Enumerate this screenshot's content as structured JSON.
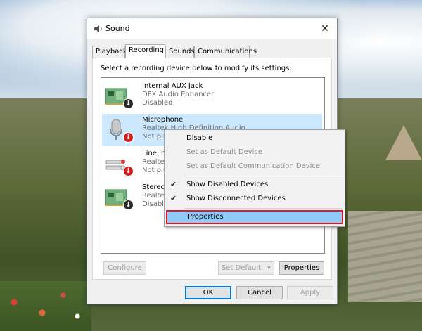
{
  "window": {
    "title": "Sound",
    "close_glyph": "✕",
    "tabs": [
      "Playback",
      "Recording",
      "Sounds",
      "Communications"
    ],
    "active_tab": "Recording",
    "instruction": "Select a recording device below to modify its settings:",
    "devices": [
      {
        "name": "Internal AUX Jack",
        "sub": "DFX Audio Enhancer",
        "status": "Disabled",
        "icon": "circuit-board-icon",
        "badge": "down-arrow-dark"
      },
      {
        "name": "Microphone",
        "sub": "Realtek High Definition Audio",
        "status": "Not plugged in",
        "icon": "microphone-icon",
        "badge": "down-arrow-red"
      },
      {
        "name": "Line In",
        "sub": "Realtek",
        "status": "Not plu",
        "icon": "line-in-jack-icon",
        "badge": "down-arrow-red"
      },
      {
        "name": "Stereo",
        "sub": "Realtek",
        "status": "Disable",
        "icon": "circuit-board-icon",
        "badge": "down-arrow-dark"
      }
    ],
    "buttons": {
      "configure": "Configure",
      "set_default": "Set Default",
      "properties": "Properties",
      "ok": "OK",
      "cancel": "Cancel",
      "apply": "Apply"
    }
  },
  "context_menu": {
    "items": [
      {
        "label": "Disable",
        "enabled": true,
        "checked": false
      },
      {
        "label": "Set as Default Device",
        "enabled": false,
        "checked": false
      },
      {
        "label": "Set as Default Communication Device",
        "enabled": false,
        "checked": false
      },
      {
        "label": "Show Disabled Devices",
        "enabled": true,
        "checked": true
      },
      {
        "label": "Show Disconnected Devices",
        "enabled": true,
        "checked": true
      },
      {
        "label": "Properties",
        "enabled": true,
        "checked": false,
        "highlighted": true
      }
    ],
    "check_glyph": "✔"
  },
  "colors": {
    "selection": "#cce8ff",
    "highlight_border": "#e01a2a",
    "highlight_fill": "#91c9f7",
    "accent": "#0078d7"
  }
}
